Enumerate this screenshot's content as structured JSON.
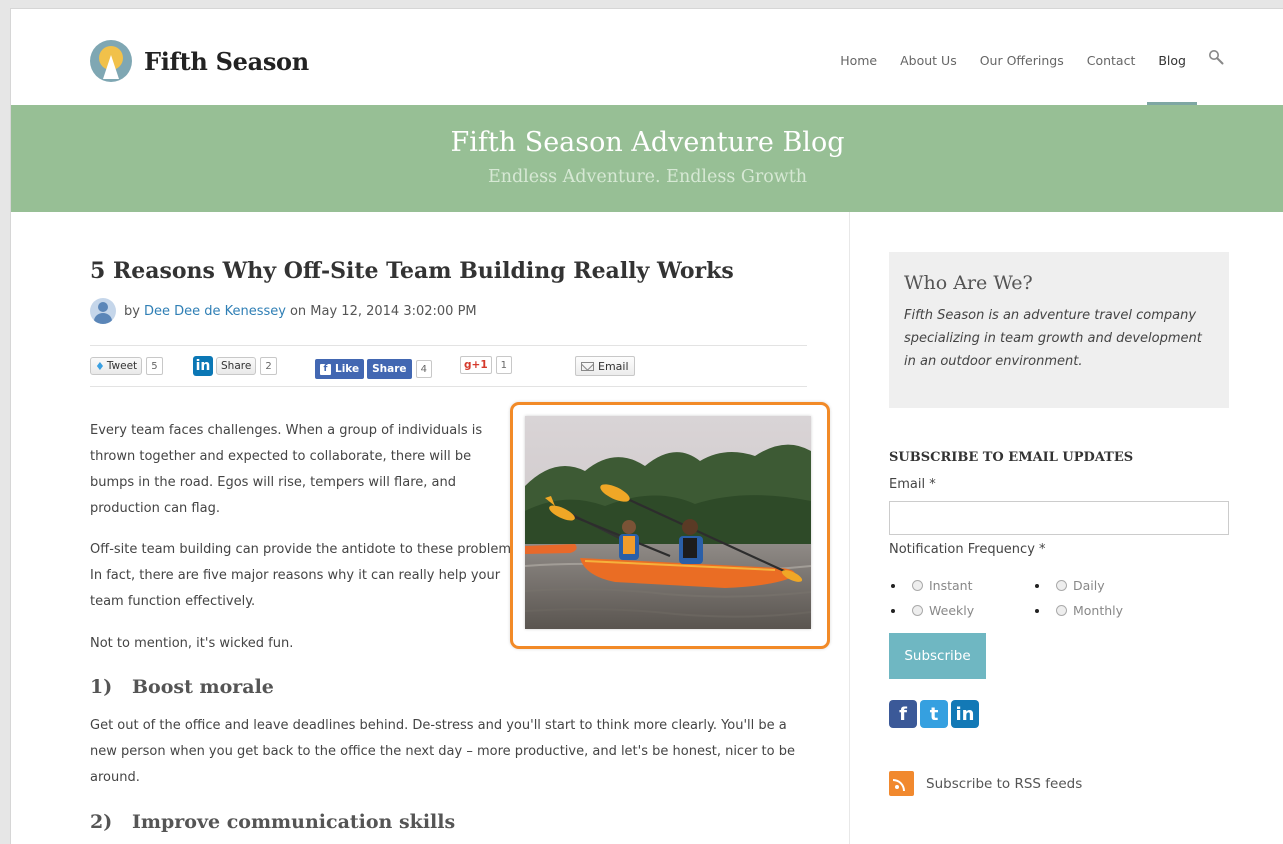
{
  "brand": {
    "name": "Fifth Season"
  },
  "nav": [
    {
      "label": "Home"
    },
    {
      "label": "About Us"
    },
    {
      "label": "Our Offerings"
    },
    {
      "label": "Contact"
    },
    {
      "label": "Blog",
      "active": true
    }
  ],
  "banner": {
    "title": "Fifth Season Adventure Blog",
    "subtitle": "Endless Adventure. Endless Growth"
  },
  "post": {
    "title": "5 Reasons Why Off-Site Team Building Really Works",
    "by": "by",
    "author": "Dee Dee de Kenessey",
    "date": "on May 12, 2014 3:02:00 PM",
    "share": {
      "tweet_label": "Tweet",
      "tweet_count": "5",
      "linkedin_label": "Share",
      "linkedin_count": "2",
      "fb_like_label": "Like",
      "fb_share_label": "Share",
      "fb_count": "4",
      "gplus_label": "+1",
      "gplus_count": "1",
      "email_label": "Email"
    },
    "paragraphs": [
      "Every team faces challenges.  When a group of individuals is thrown together and expected to collaborate, there will be bumps in the road.  Egos will rise, tempers will flare, and production can flag.",
      "Off-site team building can provide the antidote to these problems.  In fact, there are five major reasons why it can really help your team function effectively.",
      "Not to mention, it's wicked fun.",
      "Get out of the office and leave deadlines behind.  De-stress and you'll start to think more clearly.  You'll be a new person when you get back to the office the next day – more productive, and let's be honest, nicer to be around."
    ],
    "headings": [
      {
        "num": "1)",
        "text": "Boost morale"
      },
      {
        "num": "2)",
        "text": "Improve communication skills"
      }
    ]
  },
  "sidebar": {
    "who_title": "Who Are We?",
    "who_text": "Fifth Season is an adventure travel company specializing in team growth and development in an outdoor environment.",
    "subscribe_title": "SUBSCRIBE TO EMAIL UPDATES",
    "email_label": "Email *",
    "email_value": "",
    "frequency_label": "Notification Frequency *",
    "frequency_options": [
      "Instant",
      "Daily",
      "Weekly",
      "Monthly"
    ],
    "subscribe_button": "Subscribe",
    "rss_label": "Subscribe to RSS feeds"
  },
  "colors": {
    "banner": "#97bf95",
    "accent_link": "#2f7fb5",
    "photo_highlight": "#f28a27",
    "subscribe_button": "#6fb7c2"
  }
}
